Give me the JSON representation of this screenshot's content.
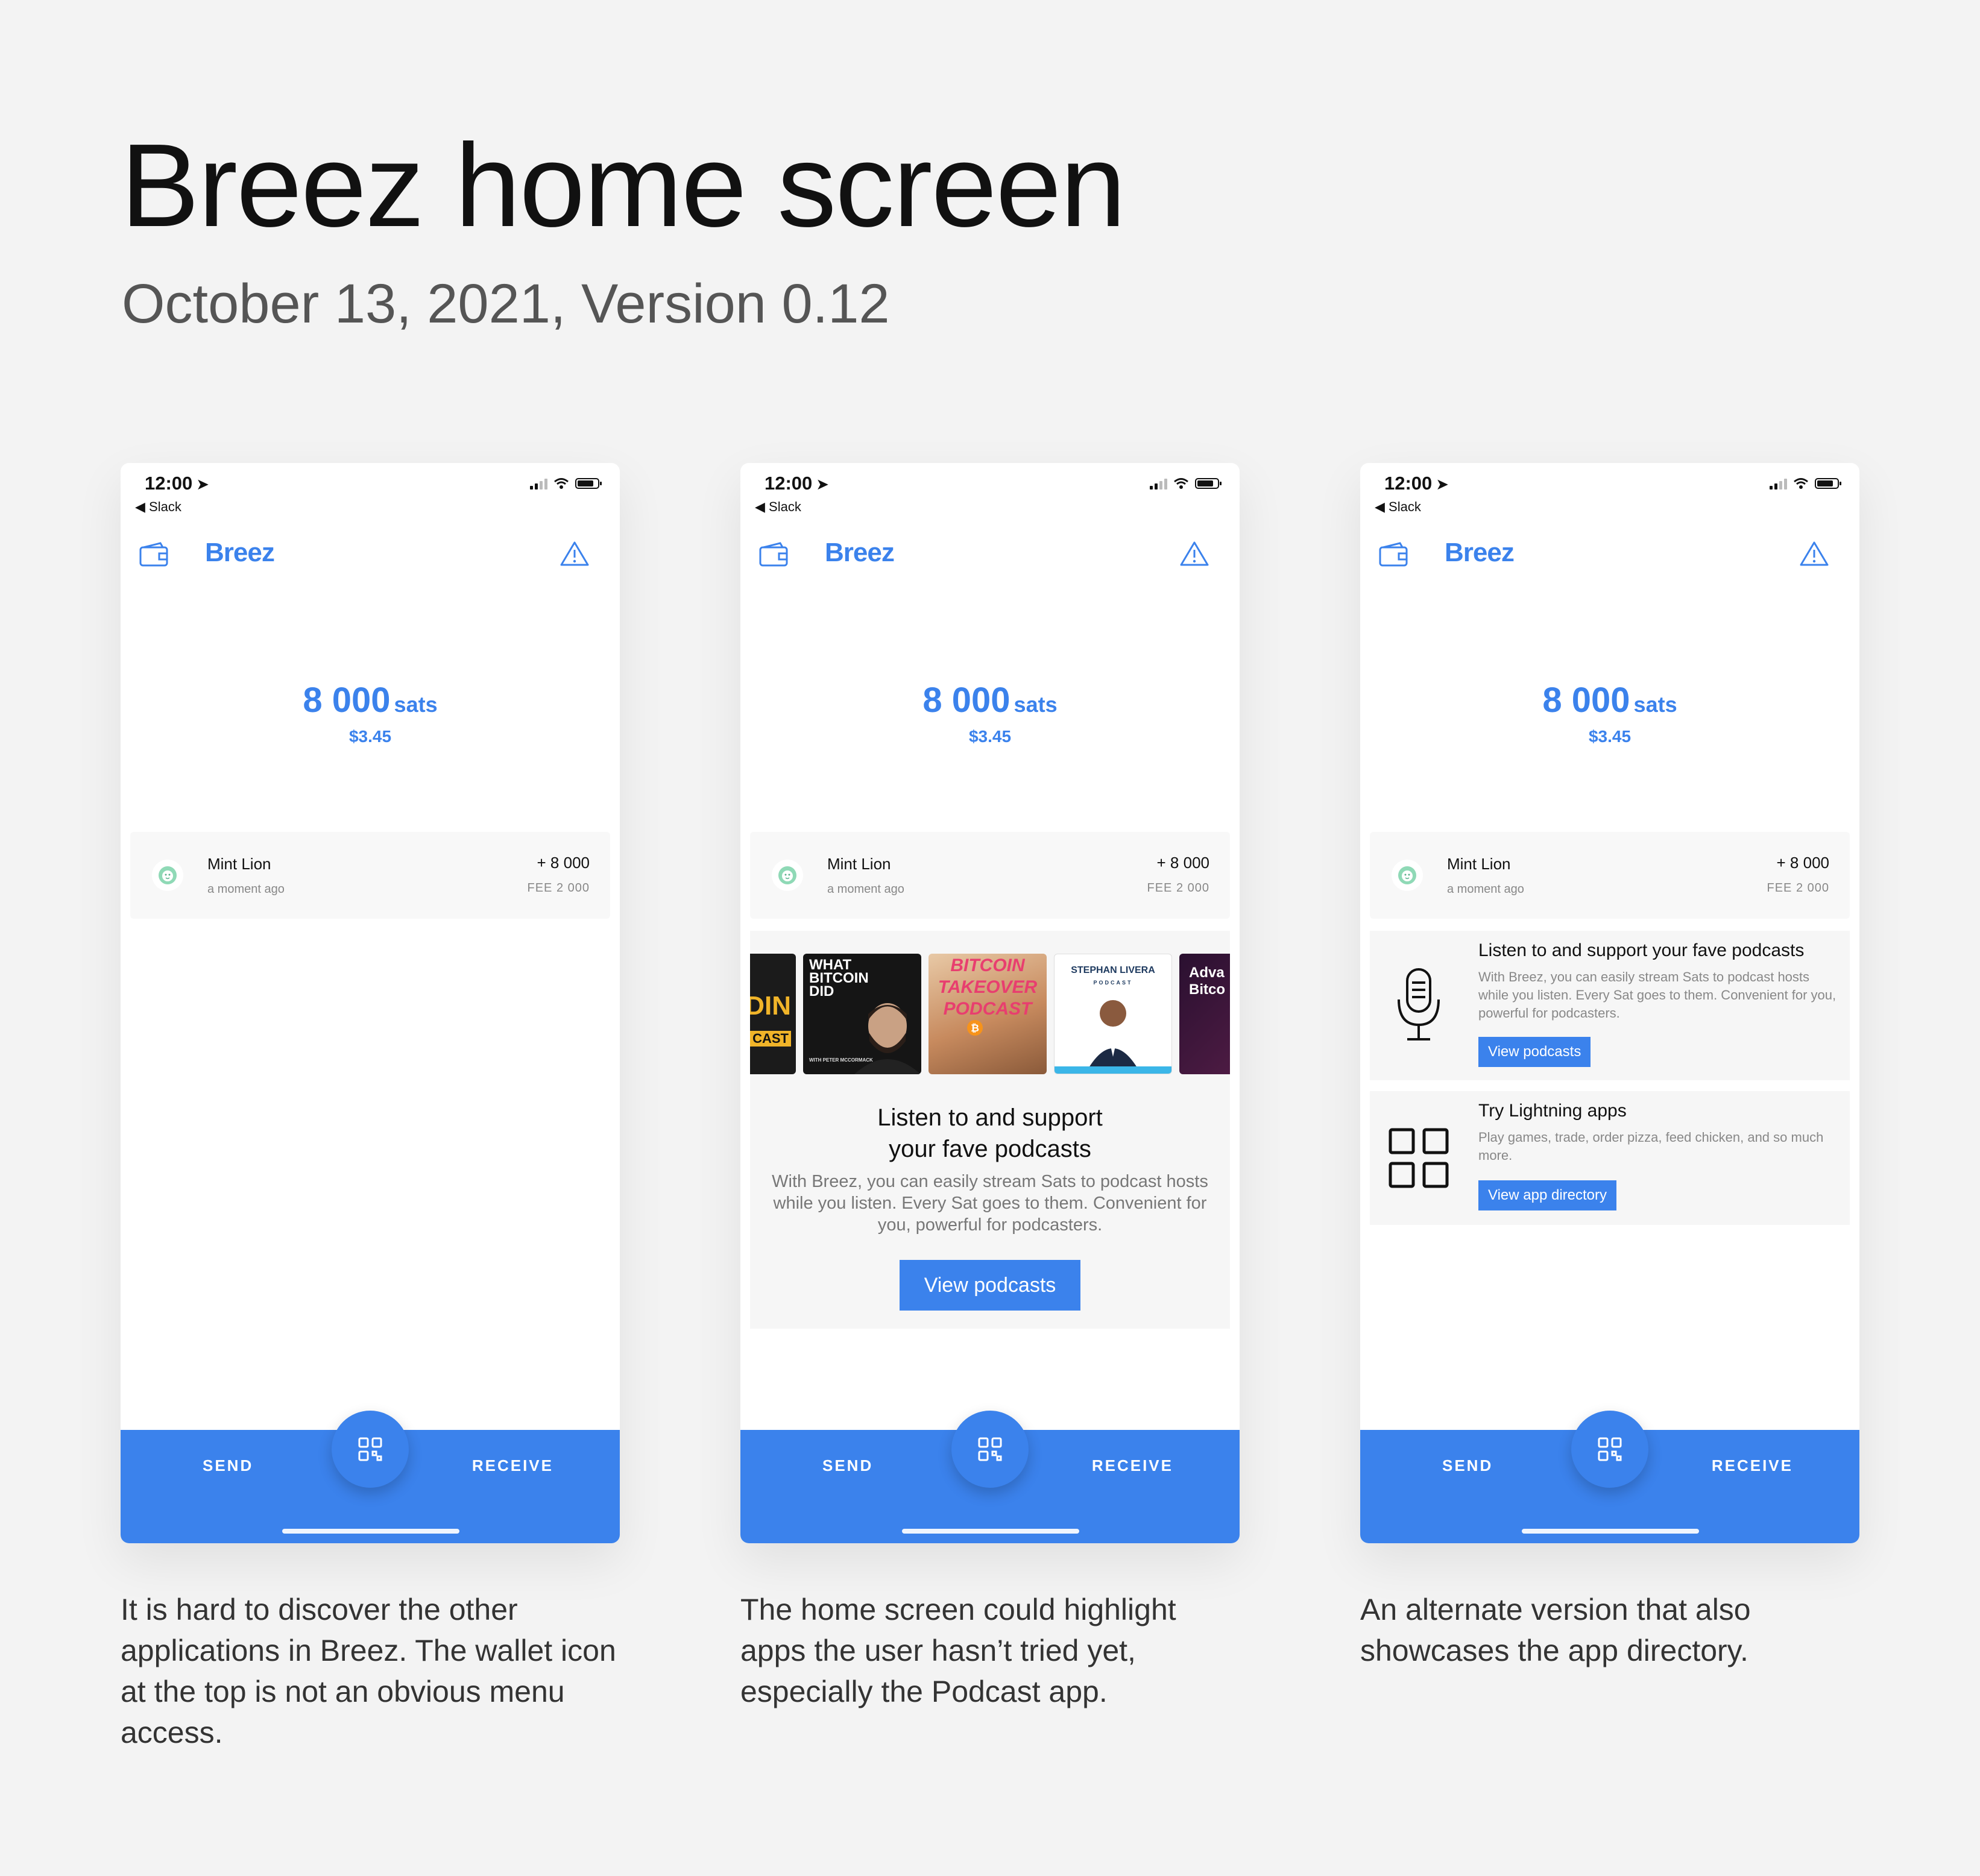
{
  "page": {
    "title": "Breez home screen",
    "subtitle": "October 13, 2021, Version 0.12"
  },
  "status_bar": {
    "time": "12:00",
    "back_app": "◀ Slack"
  },
  "app": {
    "logo": "Breez",
    "balance_amount": "8 000",
    "balance_unit": "sats",
    "balance_fiat": "$3.45",
    "brand_color": "#3b82ec"
  },
  "transaction": {
    "name": "Mint Lion",
    "time": "a moment ago",
    "amount": "+ 8 000",
    "fee": "FEE 2 000"
  },
  "bottom_bar": {
    "send": "SEND",
    "receive": "RECEIVE"
  },
  "podcast_promo": {
    "title_line1": "Listen to and support",
    "title_line2": "your fave podcasts",
    "description": "With Breez, you can easily stream Sats to podcast hosts while you listen. Every Sat goes to them. Convenient for you, powerful for podcasters.",
    "button": "View podcasts",
    "covers": [
      {
        "id": "cover-1",
        "lines": [
          "DIN",
          "CAST"
        ]
      },
      {
        "id": "cover-2",
        "lines": [
          "WHAT",
          "BITCOIN",
          "DID"
        ],
        "credit": "WITH PETER MCCORMACK"
      },
      {
        "id": "cover-3",
        "lines": [
          "BITCOIN",
          "TAKEOVER",
          "PODCAST"
        ]
      },
      {
        "id": "cover-4",
        "lines": [
          "STEPHAN LIVERA",
          "PODCAST"
        ]
      },
      {
        "id": "cover-5",
        "lines": [
          "Adva",
          "Bitco"
        ]
      }
    ]
  },
  "feature_cards": {
    "podcasts": {
      "title": "Listen to and support your fave podcasts",
      "description": "With Breez, you can easily stream Sats to podcast hosts while you listen. Every Sat goes to them. Convenient for you, powerful for podcasters.",
      "button": "View podcasts"
    },
    "apps": {
      "title": "Try Lightning apps",
      "description": "Play games, trade, order pizza, feed chicken, and so much more.",
      "button": "View app directory"
    }
  },
  "captions": {
    "one": "It is hard to discover the other applications in Breez. The wallet icon at the top is not an obvious menu access.",
    "two": "The home screen could highlight apps the user hasn’t tried yet, especially the Podcast app.",
    "three": "An alternate version that also showcases the app directory."
  }
}
